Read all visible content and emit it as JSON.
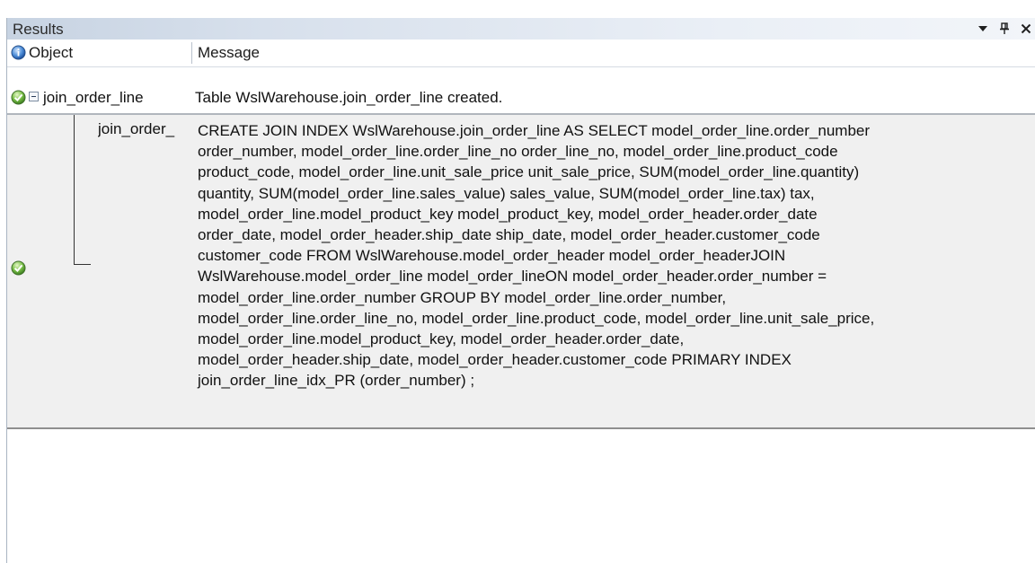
{
  "panel": {
    "title": "Results",
    "controls": [
      "dropdown-arrow",
      "pin",
      "close"
    ]
  },
  "columns": {
    "status_icon": "info-icon",
    "object": "Object",
    "message": "Message"
  },
  "rows": [
    {
      "status_icon": "success-check-icon",
      "expanded": true,
      "object": "join_order_line",
      "message": "Table WslWarehouse.join_order_line created."
    },
    {
      "status_icon": "success-check-icon",
      "object": "join_order_",
      "message_lines": [
        "CREATE JOIN INDEX WslWarehouse.join_order_line AS  SELECT model_order_line.order_number",
        "order_number, model_order_line.order_line_no order_line_no, model_order_line.product_code",
        "product_code, model_order_line.unit_sale_price unit_sale_price, SUM(model_order_line.quantity)",
        "quantity, SUM(model_order_line.sales_value) sales_value, SUM(model_order_line.tax) tax,",
        "model_order_line.model_product_key model_product_key, model_order_header.order_date",
        "order_date, model_order_header.ship_date ship_date, model_order_header.customer_code",
        "customer_code  FROM WslWarehouse.model_order_header model_order_headerJOIN",
        "WslWarehouse.model_order_line model_order_lineON model_order_header.order_number =",
        "model_order_line.order_number GROUP BY model_order_line.order_number,",
        "model_order_line.order_line_no, model_order_line.product_code, model_order_line.unit_sale_price,",
        "model_order_line.model_product_key, model_order_header.order_date,",
        "model_order_header.ship_date, model_order_header.customer_code PRIMARY INDEX",
        "join_order_line_idx_PR (order_number) ;"
      ]
    }
  ]
}
